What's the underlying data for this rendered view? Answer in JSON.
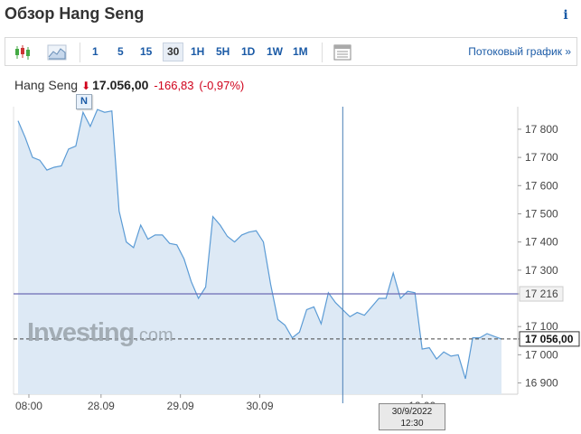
{
  "header": {
    "title": "Обзор Hang Seng",
    "info_icon": "info-icon"
  },
  "toolbar": {
    "chart_type_icons": [
      "candlestick-icon",
      "area-chart-icon"
    ],
    "intervals": [
      "1",
      "5",
      "15",
      "30",
      "1H",
      "5H",
      "1D",
      "1W",
      "1M"
    ],
    "active_interval": "30",
    "table_icon": "table-icon",
    "stream_link": "Потоковый график »"
  },
  "quote": {
    "name": "Hang Seng",
    "direction_icon": "down-arrow-icon",
    "price": "17.056,00",
    "change": "-166,83",
    "change_pct": "(-0,97%)"
  },
  "news_badge": "N",
  "watermark": {
    "brand": "Investing",
    "suffix": ".com"
  },
  "crosshair_tip": {
    "date": "30/9/2022",
    "time": "12:30"
  },
  "colors": {
    "line": "#5b9bd5",
    "fill": "#dde9f5",
    "ref_line": "#6b6bb5",
    "down": "#d0021b",
    "link": "#1a5aa6"
  },
  "chart_data": {
    "type": "area",
    "ylim": [
      16860,
      17880
    ],
    "y_ticks": [
      "17 800",
      "17 700",
      "17 600",
      "17 500",
      "17 400",
      "17 300",
      "17 216",
      "17 100",
      "17 056,00",
      "17 000",
      "16 900"
    ],
    "y_tick_values": [
      17800,
      17700,
      17600,
      17500,
      17400,
      17300,
      17216,
      17100,
      17056,
      17000,
      16900
    ],
    "x_ticks": [
      "08:00",
      "28.09",
      "29.09",
      "30.09",
      "12:00"
    ],
    "x_tick_positions": [
      1.5,
      11.5,
      22.5,
      33.5,
      56
    ],
    "reference_level": 17216,
    "last_price": 17056,
    "crosshair_index": 45,
    "values": [
      17830,
      17770,
      17700,
      17690,
      17655,
      17665,
      17670,
      17730,
      17740,
      17860,
      17810,
      17870,
      17860,
      17865,
      17510,
      17400,
      17380,
      17460,
      17410,
      17425,
      17425,
      17395,
      17390,
      17340,
      17260,
      17200,
      17240,
      17490,
      17460,
      17420,
      17400,
      17425,
      17435,
      17440,
      17400,
      17250,
      17125,
      17105,
      17060,
      17080,
      17160,
      17170,
      17110,
      17220,
      17185,
      17160,
      17135,
      17150,
      17140,
      17170,
      17200,
      17200,
      17290,
      17200,
      17225,
      17220,
      17020,
      17025,
      16985,
      17010,
      16995,
      17000,
      16915,
      17060,
      17060,
      17075,
      17065,
      17056
    ]
  }
}
